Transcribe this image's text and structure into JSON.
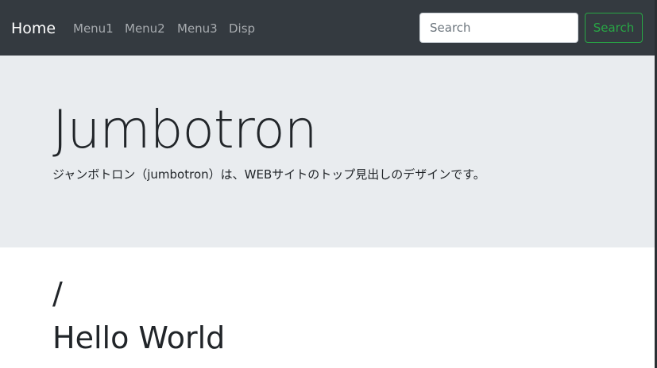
{
  "navbar": {
    "brand": "Home",
    "links": [
      "Menu1",
      "Menu2",
      "Menu3",
      "Disp"
    ],
    "search": {
      "placeholder": "Search",
      "button_label": "Search"
    },
    "colors": {
      "background": "#343a40",
      "link": "#a7abaf",
      "success": "#28a745"
    }
  },
  "jumbotron": {
    "title": "Jumbotron",
    "lead": "ジャンボトロン（jumbotron）は、WEBサイトのトップ見出しのデザインです。",
    "background": "#e9ecef"
  },
  "content": {
    "slash": "/",
    "heading": "Hello World"
  }
}
